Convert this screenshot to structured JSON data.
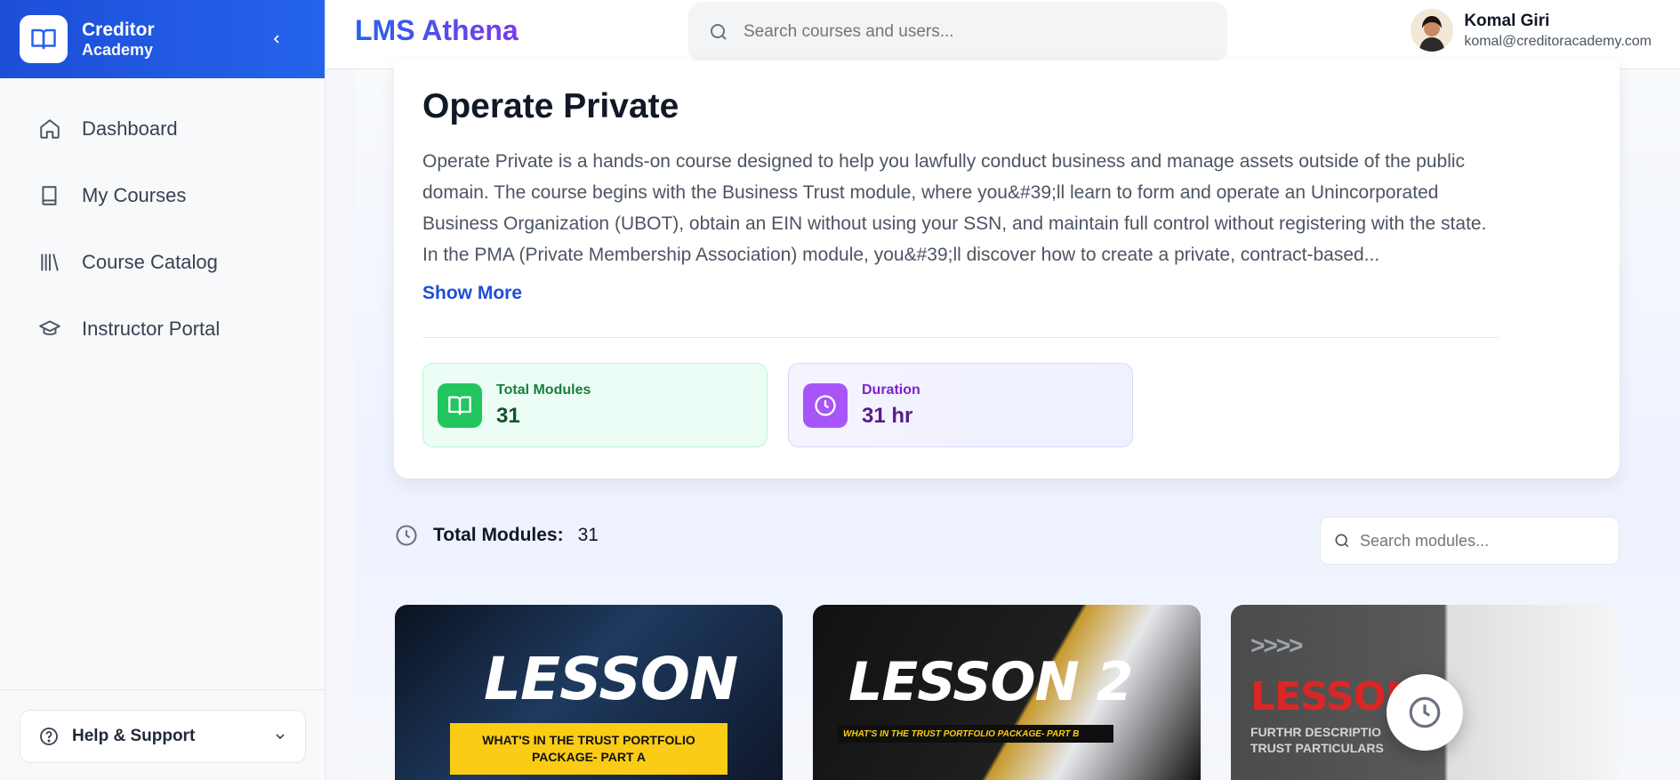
{
  "brand": {
    "title": "Creditor",
    "subtitle": "Academy"
  },
  "sidebar": {
    "items": [
      {
        "label": "Dashboard",
        "icon": "home-icon"
      },
      {
        "label": "My Courses",
        "icon": "book-icon"
      },
      {
        "label": "Course Catalog",
        "icon": "library-icon"
      },
      {
        "label": "Instructor Portal",
        "icon": "graduation-cap-icon"
      }
    ],
    "help_label": "Help & Support"
  },
  "header": {
    "app_title": "LMS Athena",
    "search_placeholder": "Search courses and users...",
    "user_name": "Komal Giri",
    "user_email": "komal@creditoracademy.com"
  },
  "course": {
    "title": "Operate Private",
    "description": "Operate Private is a hands-on course designed to help you lawfully conduct business and manage assets outside of the public domain. The course begins with the Business Trust module, where you&#39;ll learn to form and operate an Unincorporated Business Organization (UBOT), obtain an EIN without using your SSN, and maintain full control without registering with the state. In the PMA (Private Membership Association) module, you&#39;ll discover how to create a private, contract-based...",
    "show_more": "Show More",
    "stats": {
      "modules_label": "Total Modules",
      "modules_value": "31",
      "duration_label": "Duration",
      "duration_value": "31 hr"
    }
  },
  "modules": {
    "label": "Total Modules:",
    "count": "31",
    "search_placeholder": "Search modules...",
    "lessons": [
      {
        "title": "LESSON 1",
        "subtitle": "WHAT'S IN THE TRUST PORTFOLIO PACKAGE- PART A"
      },
      {
        "title": "LESSON 2",
        "subtitle": "WHAT'S IN THE TRUST PORTFOLIO PACKAGE- PART B"
      },
      {
        "title": "LESSON",
        "subtitle": "FURTHR DESCRIPTIO TRUST PARTICULARS",
        "arrows": ">>>>"
      }
    ]
  },
  "colors": {
    "brand": "#2563eb",
    "accent_purple": "#7c3aed",
    "green": "#22c55e",
    "violet": "#a855f7"
  }
}
